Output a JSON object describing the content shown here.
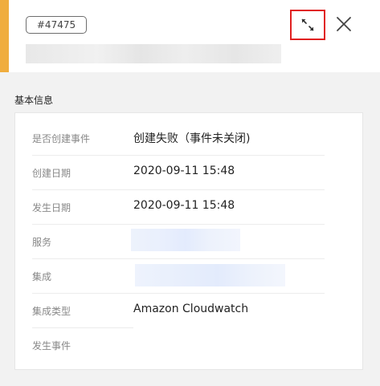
{
  "header": {
    "ticket_id": "#47475",
    "accent_color": "#f0ad3e",
    "expand_icon": "expand-arrows-icon",
    "close_icon": "close-icon"
  },
  "section": {
    "title": "基本信息"
  },
  "details": [
    {
      "label": "是否创建事件",
      "value": "创建失败（事件未关闭)"
    },
    {
      "label": "创建日期",
      "value": "2020-09-11 15:48"
    },
    {
      "label": "发生日期",
      "value": "2020-09-11 15:48"
    },
    {
      "label": "服务",
      "value": ""
    },
    {
      "label": "集成",
      "value": ""
    },
    {
      "label": "集成类型",
      "value": "Amazon Cloudwatch"
    },
    {
      "label": "发生事件",
      "value": ""
    }
  ]
}
